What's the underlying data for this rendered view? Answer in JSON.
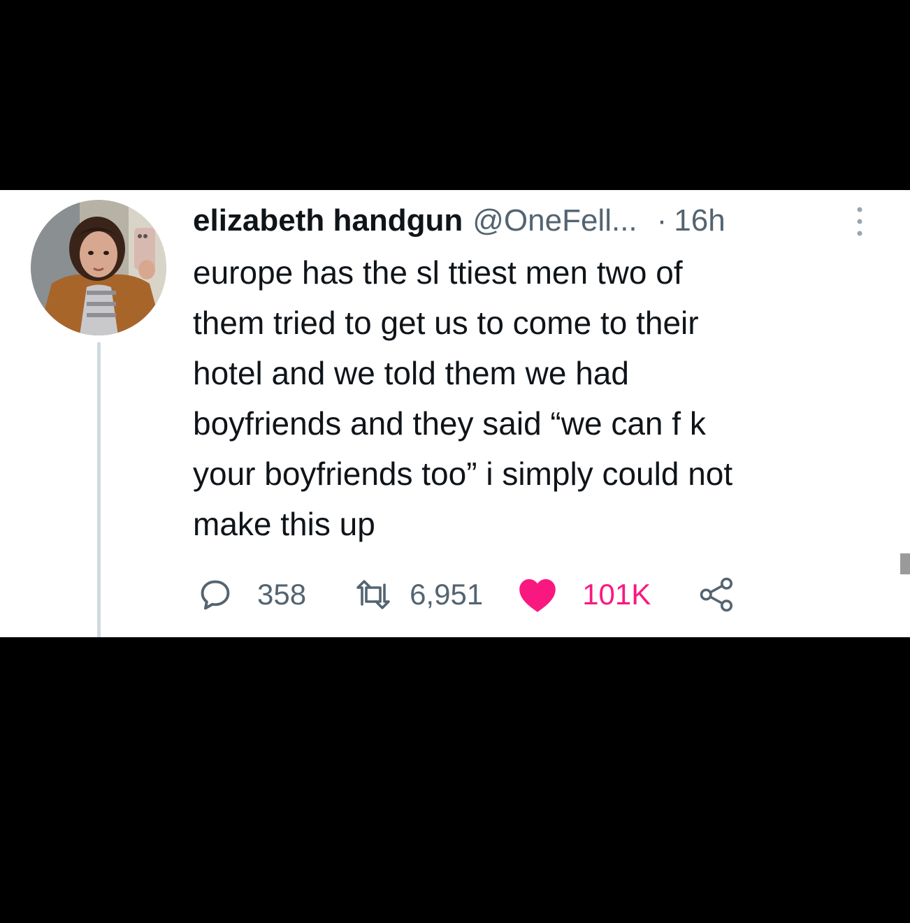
{
  "tweet": {
    "author": {
      "display_name": "elizabeth handgun",
      "handle": "@OneFell...",
      "separator": "·",
      "time": "16h"
    },
    "text": "europe has the sl  ttiest men two of\nthem tried to get us to come to their\nhotel and we told them we had\nboyfriends and they said “we can f   k\nyour boyfriends too” i simply could not\nmake this up",
    "actions": {
      "reply": {
        "icon": "comment-icon",
        "count": "358"
      },
      "retweet": {
        "icon": "retweet-icon",
        "count": "6,951"
      },
      "like": {
        "icon": "heart-icon",
        "count": "101K",
        "liked": true,
        "color": "#f91880"
      },
      "share": {
        "icon": "share-icon"
      }
    },
    "more_menu": {
      "icon": "vertical-dots-icon"
    }
  },
  "theme": {
    "page_background": "#000000",
    "card_background": "#ffffff",
    "text_primary": "#0f1419",
    "text_secondary": "#536471",
    "thread_line": "#cfd9de",
    "like_pink": "#f91880"
  }
}
